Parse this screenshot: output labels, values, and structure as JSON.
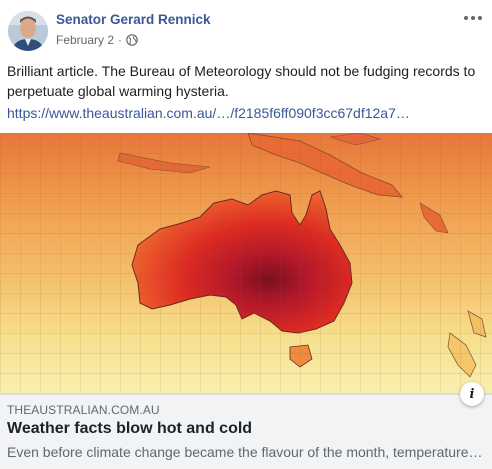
{
  "post": {
    "author": "Senator Gerard Rennick",
    "date": "February 2",
    "separator": "·",
    "privacy_icon": "globe-icon",
    "more_icon": "more-dots-icon",
    "text": "Brilliant article. The Bureau of Meteorology should not be fudging records to perpetuate global warming hysteria.",
    "link": "https://www.theaustralian.com.au/…/f2185f6ff090f3cc67df12a7…"
  },
  "card": {
    "image_icon": "australia-temperature-map",
    "info_label": "i",
    "domain": "THEAUSTRALIAN.COM.AU",
    "title": "Weather facts blow hot and cold",
    "description": "Even before climate change became the flavour of the month, temperature…"
  },
  "colors": {
    "link": "#385898",
    "secondary_text": "#606770",
    "card_bg": "#f2f3f5",
    "map_hot": "#c8201e",
    "map_warm": "#f2a24b",
    "map_cool": "#f8f0a6"
  }
}
